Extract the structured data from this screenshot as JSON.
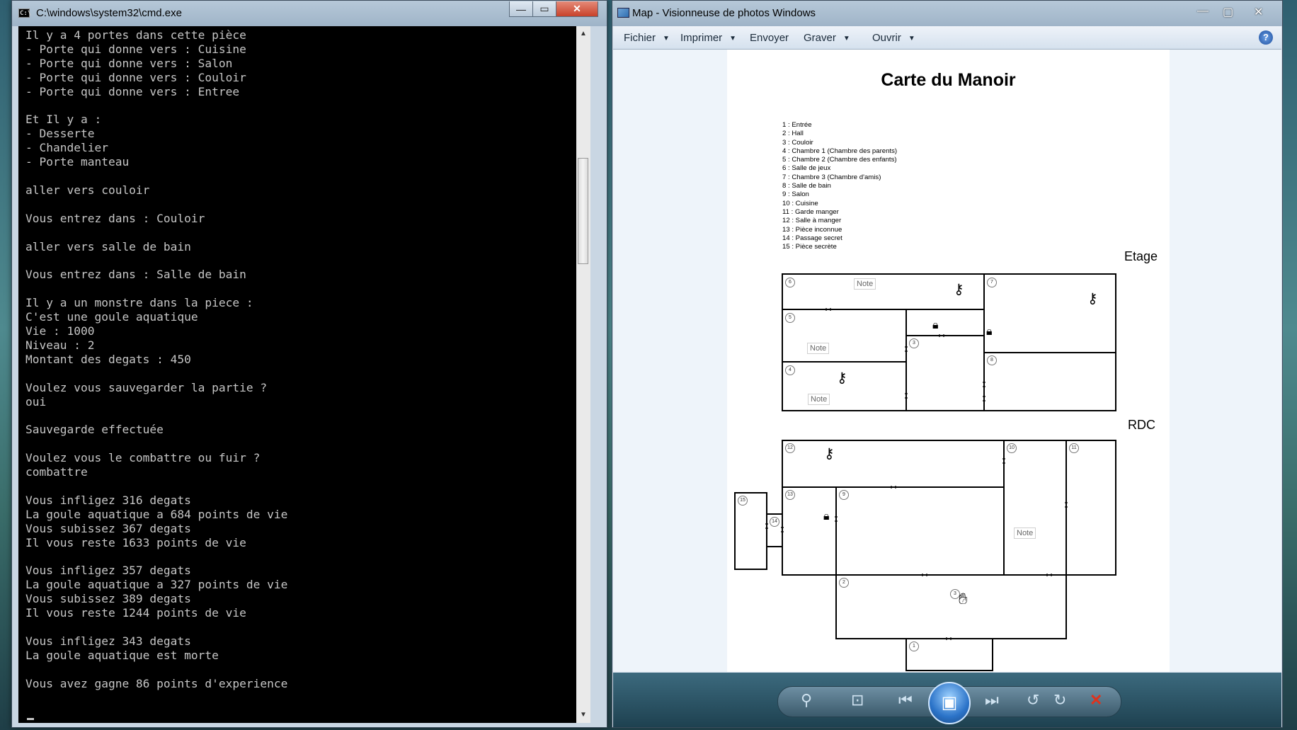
{
  "cmd": {
    "title": "C:\\windows\\system32\\cmd.exe",
    "icon_text": "C:\\",
    "minimize": "—",
    "maximize": "▭",
    "close": "✕",
    "lines": [
      "Il y a 4 portes dans cette pièce",
      "- Porte qui donne vers : Cuisine",
      "- Porte qui donne vers : Salon",
      "- Porte qui donne vers : Couloir",
      "- Porte qui donne vers : Entree",
      "",
      "Et Il y a :",
      "- Desserte",
      "- Chandelier",
      "- Porte manteau",
      "",
      "aller vers couloir",
      "",
      "Vous entrez dans : Couloir",
      "",
      "aller vers salle de bain",
      "",
      "Vous entrez dans : Salle de bain",
      "",
      "Il y a un monstre dans la piece :",
      "C'est une goule aquatique",
      "Vie : 1000",
      "Niveau : 2",
      "Montant des degats : 450",
      "",
      "Voulez vous sauvegarder la partie ?",
      "oui",
      "",
      "Sauvegarde effectuée",
      "",
      "Voulez vous le combattre ou fuir ?",
      "combattre",
      "",
      "Vous infligez 316 degats",
      "La goule aquatique a 684 points de vie",
      "Vous subissez 367 degats",
      "Il vous reste 1633 points de vie",
      "",
      "Vous infligez 357 degats",
      "La goule aquatique a 327 points de vie",
      "Vous subissez 389 degats",
      "Il vous reste 1244 points de vie",
      "",
      "Vous infligez 343 degats",
      "La goule aquatique est morte",
      "",
      "Vous avez gagne 86 points d'experience"
    ]
  },
  "viewer": {
    "title": "Map - Visionneuse de photos Windows",
    "minimize": "—",
    "maximize": "▢",
    "close": "✕",
    "menu": {
      "fichier": "Fichier",
      "imprimer": "Imprimer",
      "envoyer": "Envoyer",
      "graver": "Graver",
      "ouvrir": "Ouvrir",
      "help": "?"
    },
    "map": {
      "title": "Carte du Manoir",
      "legend": [
        "1 : Entrée",
        "2 : Hall",
        "3 : Couloir",
        "4 : Chambre 1 (Chambre des parents)",
        "5 : Chambre 2 (Chambre des enfants)",
        "6 : Salle de jeux",
        "7 : Chambre 3 (Chambre d'amis)",
        "8 : Salle de bain",
        "9 : Salon",
        "10 : Cuisine",
        "11 : Garde manger",
        "12 : Salle à manger",
        "13 : Pièce inconnue",
        "14 : Passage secret",
        "15 : Pièce secrète"
      ],
      "floor_upper": "Etage",
      "floor_ground": "RDC",
      "note_label": "Note",
      "room_numbers": [
        "6",
        "5",
        "4",
        "3",
        "7",
        "8",
        "12",
        "10",
        "11",
        "15",
        "13",
        "9",
        "14",
        "2",
        "3",
        "1"
      ]
    },
    "controls": {
      "zoom": "⚲",
      "fit": "⊡",
      "prev": "⏮",
      "slideshow": "▣",
      "next": "⏭",
      "rotate_left": "↺",
      "rotate_right": "↻",
      "delete": "✕"
    }
  }
}
